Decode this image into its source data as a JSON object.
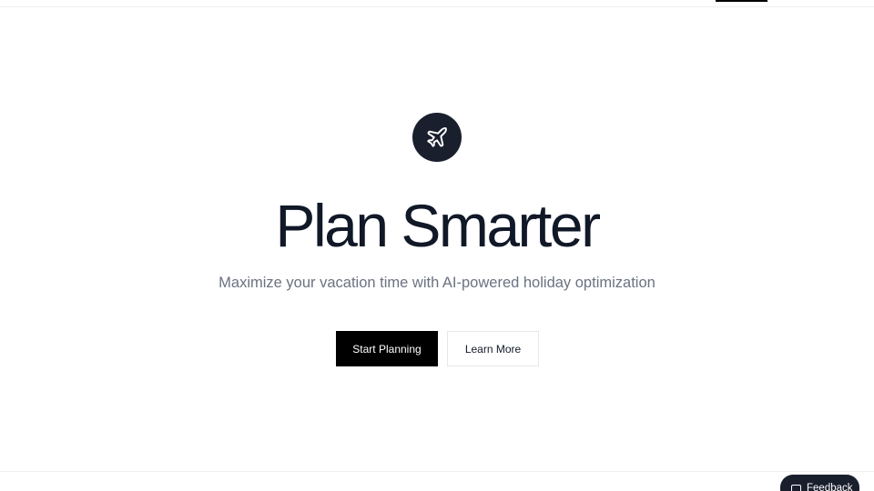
{
  "header": {
    "active_indicator_color": "#000000"
  },
  "hero": {
    "icon": "airplane-icon",
    "icon_bg_color": "#1a1f2e",
    "title": "Plan Smarter",
    "subtitle": "Maximize your vacation time with AI-powered holiday optimization"
  },
  "actions": {
    "primary_label": "Start Planning",
    "primary_color": "#000000",
    "secondary_label": "Learn More"
  },
  "feedback": {
    "icon": "message-square-icon",
    "label": "Feedback",
    "bg_color": "#1a1f2e"
  }
}
